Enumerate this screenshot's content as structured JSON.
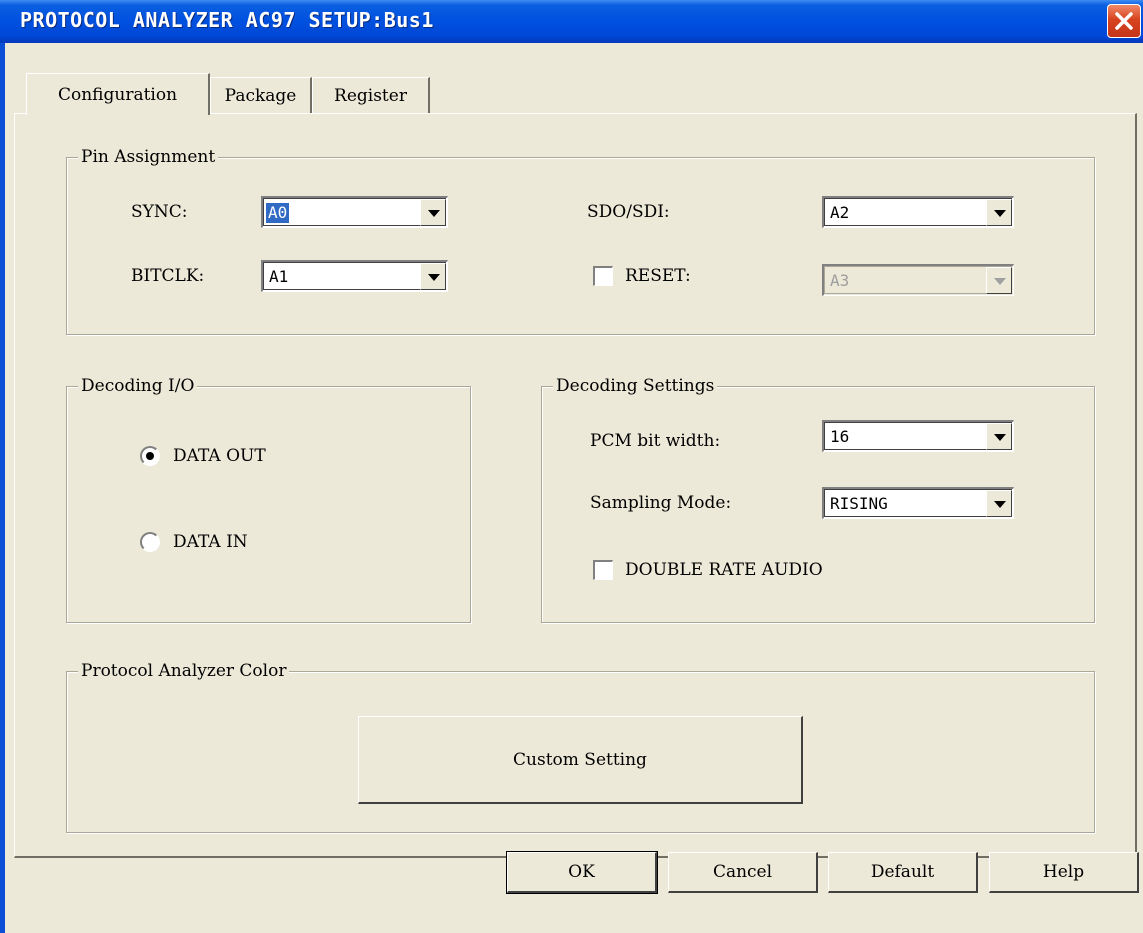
{
  "window": {
    "title": "PROTOCOL ANALYZER AC97 SETUP:Bus1"
  },
  "tabs": [
    {
      "label": "Configuration",
      "active": true
    },
    {
      "label": "Package",
      "active": false
    },
    {
      "label": "Register",
      "active": false
    }
  ],
  "pin_assignment": {
    "title": "Pin Assignment",
    "sync_label": "SYNC:",
    "sync_value": "A0",
    "bitclk_label": "BITCLK:",
    "bitclk_value": "A1",
    "sdo_sdi_label": "SDO/SDI:",
    "sdo_sdi_value": "A2",
    "reset_label": "RESET:",
    "reset_checked": false,
    "reset_value": "A3"
  },
  "decoding_io": {
    "title": "Decoding I/O",
    "options": [
      {
        "label": "DATA OUT",
        "selected": true
      },
      {
        "label": "DATA IN",
        "selected": false
      }
    ]
  },
  "decoding_settings": {
    "title": "Decoding Settings",
    "pcm_label": "PCM bit width:",
    "pcm_value": "16",
    "sampling_label": "Sampling Mode:",
    "sampling_value": "RISING",
    "double_rate_label": "DOUBLE RATE AUDIO",
    "double_rate_checked": false
  },
  "color_group": {
    "title": "Protocol Analyzer Color",
    "custom_button": "Custom Setting"
  },
  "footer": {
    "ok": "OK",
    "cancel": "Cancel",
    "default": "Default",
    "help": "Help"
  },
  "icons": {
    "close": "close-icon",
    "dropdown": "chevron-down-icon",
    "radio": "radio-icon",
    "checkbox": "checkbox-icon"
  },
  "colors": {
    "title_bar": "#0050e0",
    "dialog_bg": "#ece9d8",
    "close_button": "#d8431f",
    "selection": "#316ac5"
  }
}
